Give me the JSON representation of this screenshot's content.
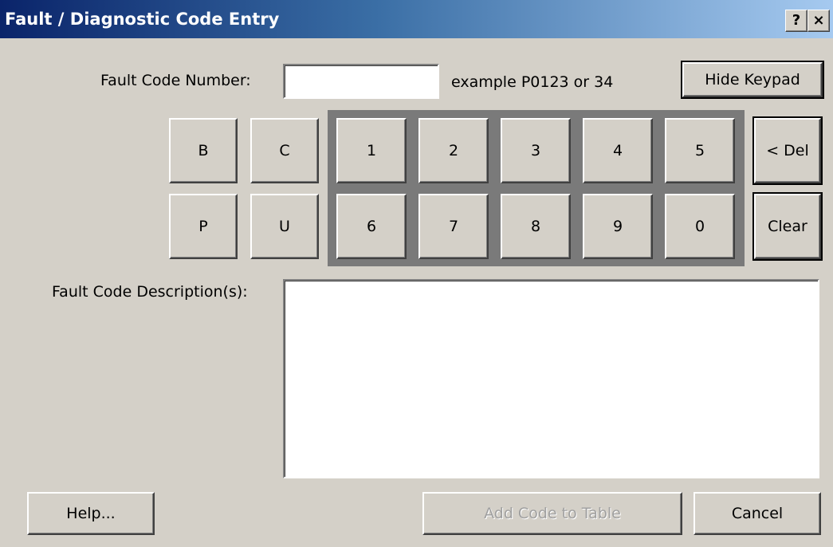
{
  "window": {
    "title": "Fault / Diagnostic Code Entry",
    "help_glyph": "?",
    "close_glyph": "×"
  },
  "form": {
    "fault_code_label": "Fault Code Number:",
    "fault_code_value": "",
    "example_text": "example P0123 or 34",
    "hide_keypad_label": "Hide Keypad",
    "description_label": "Fault Code Description(s):",
    "description_value": ""
  },
  "keypad": {
    "letters_row1": [
      "B",
      "C"
    ],
    "letters_row2": [
      "P",
      "U"
    ],
    "digits_row1": [
      "1",
      "2",
      "3",
      "4",
      "5"
    ],
    "digits_row2": [
      "6",
      "7",
      "8",
      "9",
      "0"
    ],
    "del_label": "< Del",
    "clear_label": "Clear"
  },
  "footer": {
    "help_label": "Help...",
    "add_label": "Add Code to Table",
    "cancel_label": "Cancel"
  }
}
